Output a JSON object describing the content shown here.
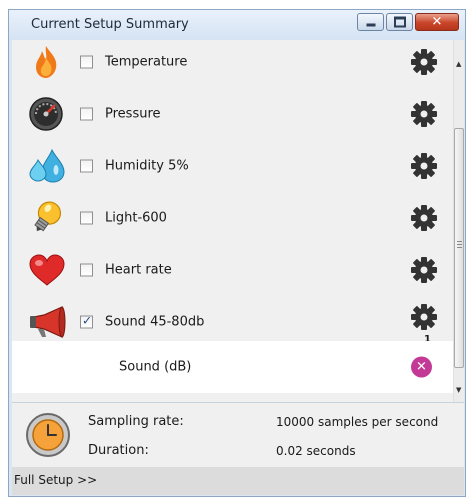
{
  "window": {
    "title": "Current Setup Summary",
    "buttons": [
      "minimize",
      "maximize",
      "close"
    ]
  },
  "sensors": [
    {
      "label": "Temperature",
      "icon": "flame-icon",
      "checked": false
    },
    {
      "label": "Pressure",
      "icon": "gauge-icon",
      "checked": false
    },
    {
      "label": "Humidity 5%",
      "icon": "water-drops-icon",
      "checked": false
    },
    {
      "label": "Light-600",
      "icon": "light-bulb-icon",
      "checked": false
    },
    {
      "label": "Heart rate",
      "icon": "heart-icon",
      "checked": false
    },
    {
      "label": "Sound 45-80db",
      "icon": "megaphone-icon",
      "checked": true,
      "gear_count": "1"
    }
  ],
  "selected_channel": {
    "label": "Sound (dB)",
    "remove_icon": "remove-icon"
  },
  "sampling": {
    "rate_label": "Sampling rate:",
    "rate_value": "10000 samples per second",
    "duration_label": "Duration:",
    "duration_value": "0.02 seconds"
  },
  "footer": {
    "full_setup_label": "Full Setup >>"
  },
  "colors": {
    "accent": "#c23a96",
    "title_bar": "#dbe6f3",
    "close_button": "#c9452a"
  }
}
